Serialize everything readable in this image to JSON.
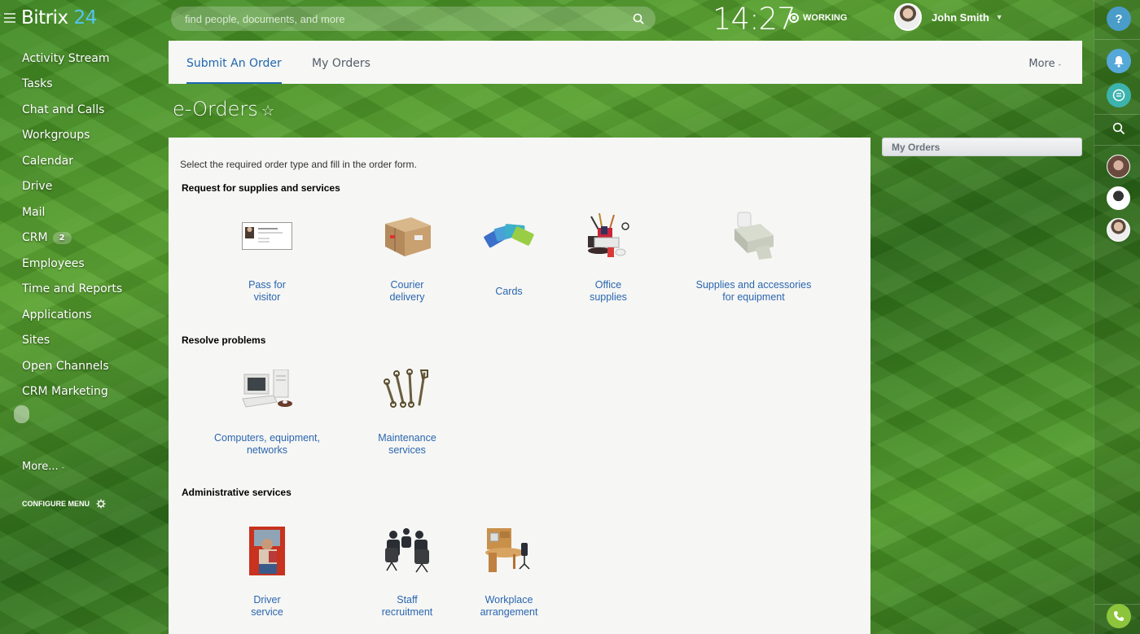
{
  "header": {
    "logo_text": "Bitrix",
    "logo_num": "24",
    "search_placeholder": "find people, documents, and more",
    "clock": "14:27",
    "status": "WORKING",
    "user_name": "John Smith"
  },
  "leftmenu": {
    "items": [
      {
        "label": "Activity Stream"
      },
      {
        "label": "Tasks"
      },
      {
        "label": "Chat and Calls"
      },
      {
        "label": "Workgroups"
      },
      {
        "label": "Calendar"
      },
      {
        "label": "Drive"
      },
      {
        "label": "Mail"
      },
      {
        "label": "CRM",
        "badge": "2"
      },
      {
        "label": "Employees"
      },
      {
        "label": "Time and Reports"
      },
      {
        "label": "Applications"
      },
      {
        "label": "Sites"
      },
      {
        "label": "Open Channels"
      },
      {
        "label": "CRM Marketing"
      }
    ],
    "more_label": "More...",
    "configure_label": "CONFIGURE MENU"
  },
  "tabs": {
    "items": [
      {
        "label": "Submit An Order",
        "active": true
      },
      {
        "label": "My Orders",
        "active": false
      }
    ],
    "more_label": "More"
  },
  "page": {
    "title": "e-Orders",
    "intro": "Select the required order type and fill in the order form.",
    "sections": [
      {
        "title": "Request for supplies and services",
        "tiles": [
          {
            "label_1": "Pass for",
            "label_2": "visitor",
            "icon": "id-card-icon"
          },
          {
            "label_1": "Courier",
            "label_2": "delivery",
            "icon": "parcel-icon"
          },
          {
            "label_1": "Cards",
            "label_2": "",
            "icon": "cards-icon"
          },
          {
            "label_1": "Office",
            "label_2": "supplies",
            "icon": "office-supplies-icon"
          },
          {
            "label_1": "Supplies and accessories",
            "label_2": "for equipment",
            "icon": "printer-icon"
          }
        ]
      },
      {
        "title": "Resolve problems",
        "tiles": [
          {
            "label_1": "Computers, equipment,",
            "label_2": "networks",
            "icon": "computer-icon"
          },
          {
            "label_1": "Maintenance",
            "label_2": "services",
            "icon": "wrenches-icon"
          }
        ]
      },
      {
        "title": "Administrative services",
        "tiles": [
          {
            "label_1": "Driver",
            "label_2": "service",
            "icon": "driver-icon"
          },
          {
            "label_1": "Staff",
            "label_2": "recruitment",
            "icon": "meeting-icon"
          },
          {
            "label_1": "Workplace",
            "label_2": "arrangement",
            "icon": "desk-icon"
          }
        ]
      }
    ]
  },
  "widget": {
    "title": "My Orders"
  },
  "rightbar": {
    "help_label": "?"
  },
  "colors": {
    "accent": "#2067b0",
    "link": "#2a66b0",
    "logo_num": "#55c4f0",
    "notify": "#55a8d8",
    "chat": "#3cb3ad",
    "phone": "#8cc43c"
  }
}
